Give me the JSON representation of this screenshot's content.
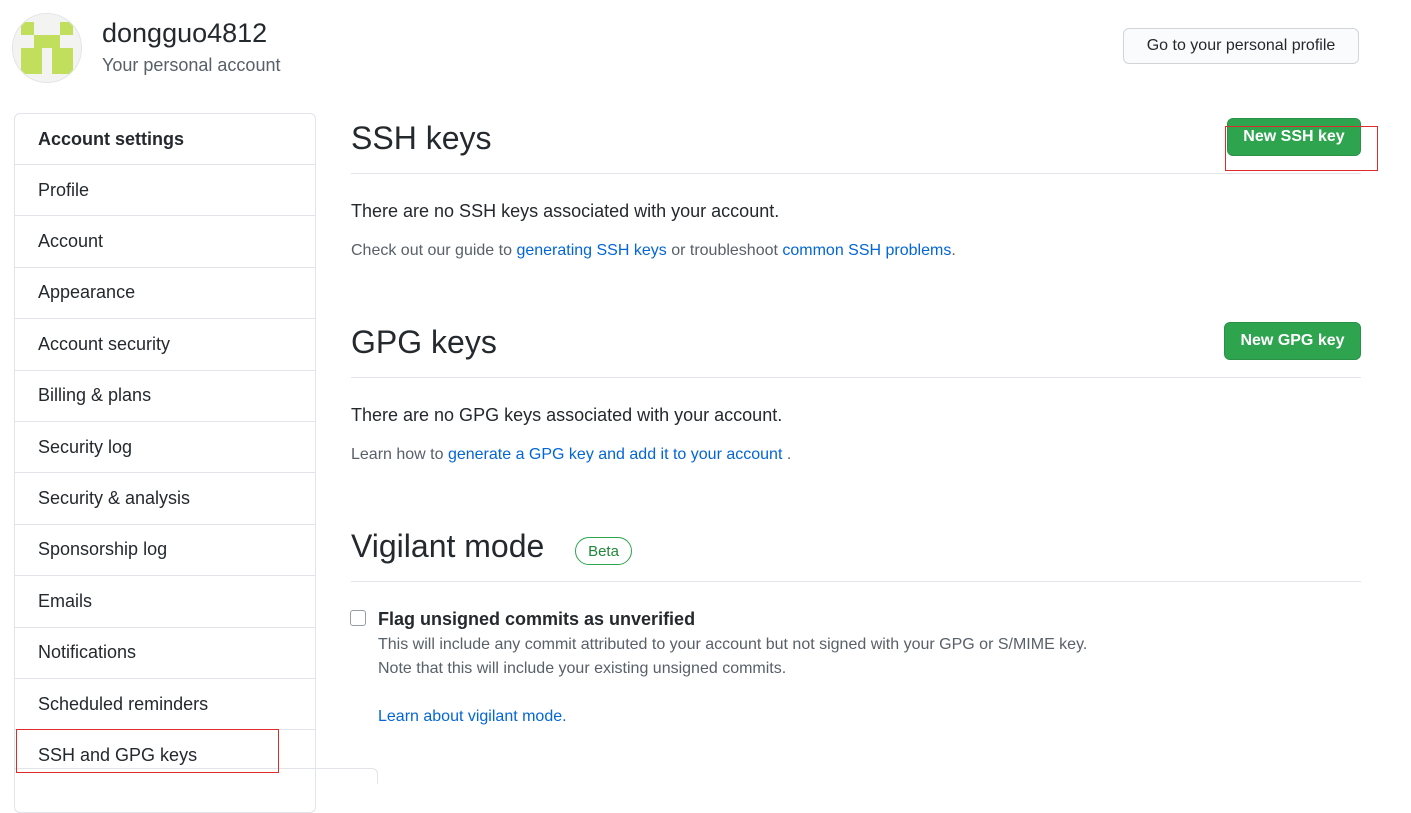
{
  "header": {
    "username": "dongguo4812",
    "subtitle": "Your personal account",
    "profile_button": "Go to your personal profile"
  },
  "sidebar": {
    "heading": "Account settings",
    "items": [
      {
        "label": "Profile"
      },
      {
        "label": "Account"
      },
      {
        "label": "Appearance"
      },
      {
        "label": "Account security"
      },
      {
        "label": "Billing & plans"
      },
      {
        "label": "Security log"
      },
      {
        "label": "Security & analysis"
      },
      {
        "label": "Sponsorship log"
      },
      {
        "label": "Emails"
      },
      {
        "label": "Notifications"
      },
      {
        "label": "Scheduled reminders"
      },
      {
        "label": "SSH and GPG keys"
      }
    ],
    "selected_index": 11
  },
  "ssh": {
    "title": "SSH keys",
    "new_button": "New SSH key",
    "empty_text": "There are no SSH keys associated with your account.",
    "help_prefix": "Check out our guide to ",
    "help_link1": "generating SSH keys",
    "help_mid": " or troubleshoot ",
    "help_link2": "common SSH problems",
    "help_suffix": "."
  },
  "gpg": {
    "title": "GPG keys",
    "new_button": "New GPG key",
    "empty_text": "There are no GPG keys associated with your account.",
    "help_prefix": "Learn how to ",
    "help_link": "generate a GPG key and add it to your account",
    "help_suffix": " ."
  },
  "vigilant": {
    "title": "Vigilant mode",
    "badge": "Beta",
    "checkbox_label": "Flag unsigned commits as unverified",
    "checked": false,
    "desc_line1": "This will include any commit attributed to your account but not signed with your GPG or S/MIME key.",
    "desc_line2": "Note that this will include your existing unsigned commits.",
    "learn_link": "Learn about vigilant mode."
  },
  "colors": {
    "accent_green": "#2ea44f",
    "link_blue": "#0366d6",
    "highlight_red": "#e02b2b",
    "avatar_green": "#c1de5c"
  },
  "icons": {
    "avatar": "identicon"
  }
}
